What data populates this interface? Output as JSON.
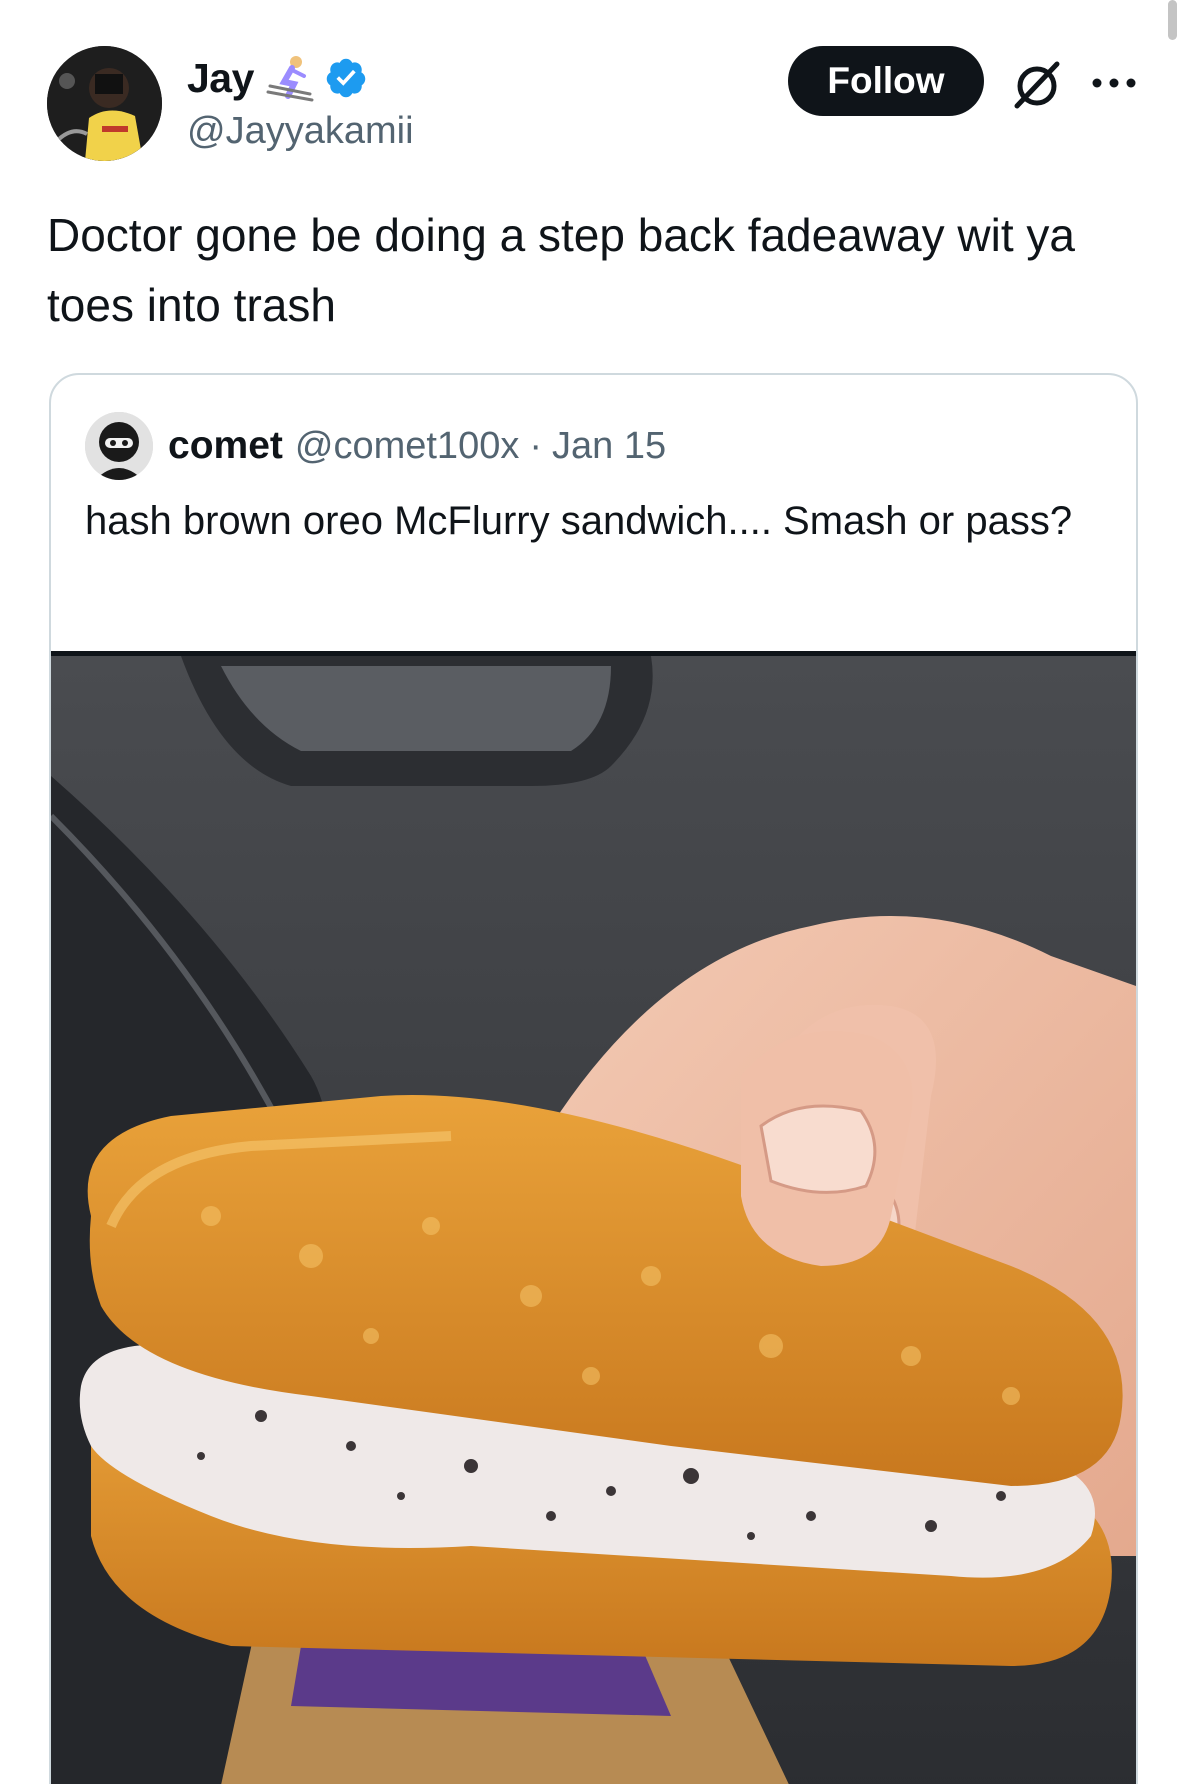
{
  "author": {
    "name": "Jay",
    "handle": "@Jayyakamii",
    "verified": true,
    "emoji_icon": "skier-emoji-icon"
  },
  "actions": {
    "follow_label": "Follow",
    "grok_icon": "grok-icon",
    "more_icon": "more-icon"
  },
  "tweet": {
    "text": "Doctor gone be doing a step back fadeaway wit ya toes into trash"
  },
  "quote": {
    "name": "comet",
    "handle": "@comet100x",
    "separator": "·",
    "date": "Jan 15",
    "text": "hash brown oreo McFlurry sandwich.... Smash or pass?"
  },
  "colors": {
    "text": "#0f1419",
    "secondary": "#536471",
    "verified": "#1d9bf0",
    "border": "#cfd9de"
  }
}
